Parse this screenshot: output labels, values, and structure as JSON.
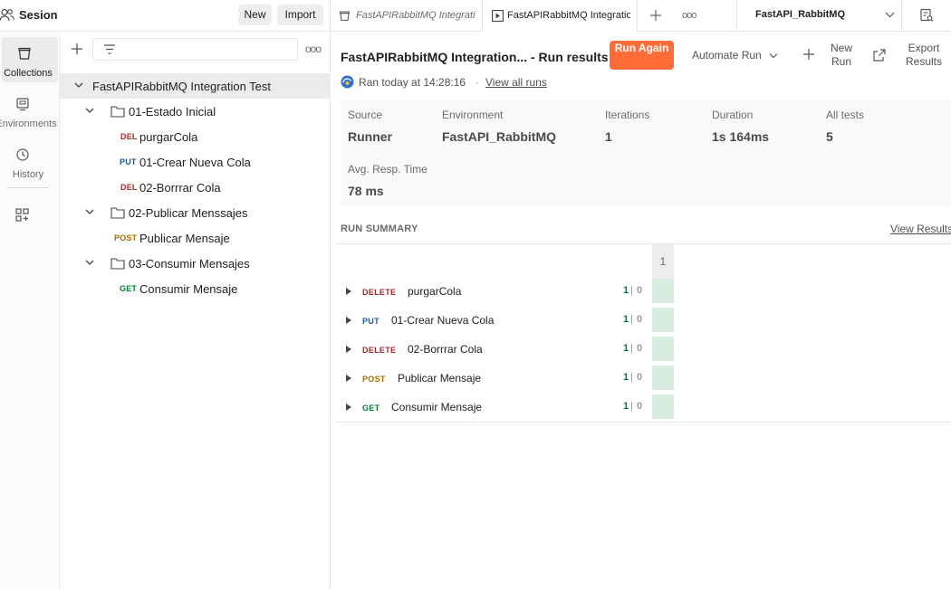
{
  "workspace": {
    "name": "Sesion",
    "new_label": "New",
    "import_label": "Import"
  },
  "sidebar": {
    "items": [
      {
        "label": "Collections",
        "icon": "collections-icon"
      },
      {
        "label": "Environments",
        "icon": "environments-icon"
      },
      {
        "label": "History",
        "icon": "history-icon"
      }
    ]
  },
  "tree": {
    "collection": "FastAPIRabbitMQ Integration Test",
    "folders": [
      {
        "name": "01-Estado Inicial",
        "requests": [
          {
            "method": "DEL",
            "name": "purgarCola"
          },
          {
            "method": "PUT",
            "name": "01-Crear Nueva Cola"
          },
          {
            "method": "DEL",
            "name": "02-Borrrar Cola"
          }
        ]
      },
      {
        "name": "02-Publicar Menssajes",
        "requests": [
          {
            "method": "POST",
            "name": "Publicar Mensaje"
          }
        ]
      },
      {
        "name": "03-Consumir Mensajes",
        "requests": [
          {
            "method": "GET",
            "name": "Consumir Mensaje"
          }
        ]
      }
    ]
  },
  "tabs": [
    {
      "label": "FastAPIRabbitMQ Integration Test",
      "icon": "collection-tab-icon"
    },
    {
      "label": "FastAPIRabbitMQ Integration Test - Run results",
      "icon": "runner-tab-icon"
    }
  ],
  "environment": {
    "selected": "FastAPI_RabbitMQ"
  },
  "run": {
    "title": "FastAPIRabbitMQ Integration... - Run results",
    "run_again": "Run Again",
    "automate": "Automate Run",
    "new_run": "New Run",
    "export": "Export Results",
    "ran_text": "Ran today at 14:28:16",
    "dot": "·",
    "view_all": "View all runs"
  },
  "stats": [
    {
      "label": "Source",
      "value": "Runner"
    },
    {
      "label": "Environment",
      "value": "FastAPI_RabbitMQ"
    },
    {
      "label": "Iterations",
      "value": "1"
    },
    {
      "label": "Duration",
      "value": "1s 164ms"
    },
    {
      "label": "All tests",
      "value": "5"
    },
    {
      "label": "Avg. Resp. Time",
      "value": "78 ms"
    }
  ],
  "summary": {
    "title": "RUN SUMMARY",
    "view_results": "View Results",
    "iteration_header": "1",
    "separator": "|",
    "rows": [
      {
        "method": "DELETE",
        "name": "purgarCola",
        "passed": "1",
        "failed": "0"
      },
      {
        "method": "PUT",
        "name": "01-Crear Nueva Cola",
        "passed": "1",
        "failed": "0"
      },
      {
        "method": "DELETE",
        "name": "02-Borrrar Cola",
        "passed": "1",
        "failed": "0"
      },
      {
        "method": "POST",
        "name": "Publicar Mensaje",
        "passed": "1",
        "failed": "0"
      },
      {
        "method": "GET",
        "name": "Consumir Mensaje",
        "passed": "1",
        "failed": "0"
      }
    ]
  },
  "colors": {
    "accent": "#ff6c37",
    "pass": "#007f31",
    "delete": "#a52a2a",
    "put": "#0b5cad",
    "post": "#a96b00",
    "get": "#007f31"
  }
}
